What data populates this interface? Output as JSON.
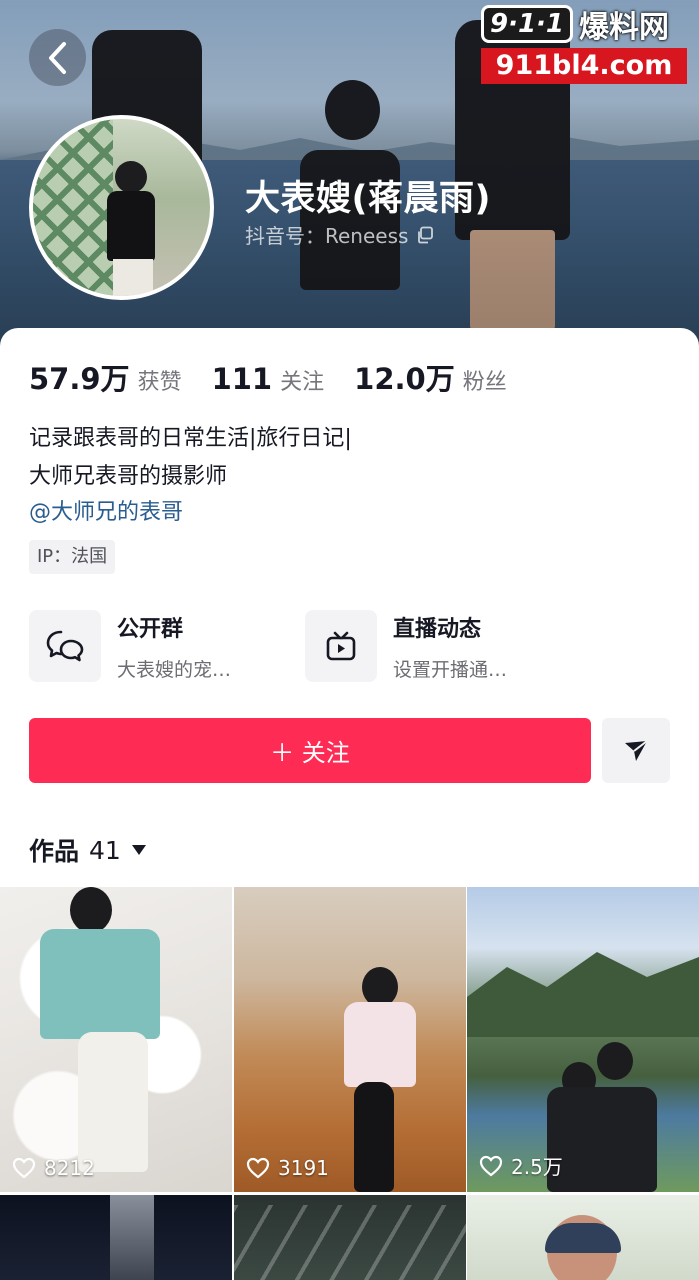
{
  "header": {
    "back_icon": "chevron-left-icon",
    "username": "大表嫂(蒋晨雨)",
    "douyin_id": "抖音号：Reneess",
    "copy_icon": "copy-icon"
  },
  "watermark": {
    "logo": "9·1·1",
    "text": "爆料网",
    "url": "911bl4.com"
  },
  "stats": [
    {
      "value": "57.9万",
      "label": "获赞"
    },
    {
      "value": "111",
      "label": "关注"
    },
    {
      "value": "12.0万",
      "label": "粉丝"
    }
  ],
  "bio": {
    "line1": "记录跟表哥的日常生活|旅行日记|",
    "line2": "大师兄表哥的摄影师",
    "mention": "@大师兄的表哥",
    "ip": "IP：法国"
  },
  "features": [
    {
      "icon": "group-chat-icon",
      "title": "公开群",
      "subtitle": "大表嫂的宠…"
    },
    {
      "icon": "live-tv-icon",
      "title": "直播动态",
      "subtitle": "设置开播通…"
    }
  ],
  "actions": {
    "follow_label": "＋ 关注",
    "share_icon": "send-icon"
  },
  "works": {
    "label": "作品",
    "count": "41"
  },
  "videos": [
    {
      "likes": "8212"
    },
    {
      "likes": "3191"
    },
    {
      "likes": "2.5万"
    }
  ],
  "colors": {
    "accent": "#fe2c55",
    "mention": "#2a5d8f",
    "watermark_red": "#d8161f"
  }
}
